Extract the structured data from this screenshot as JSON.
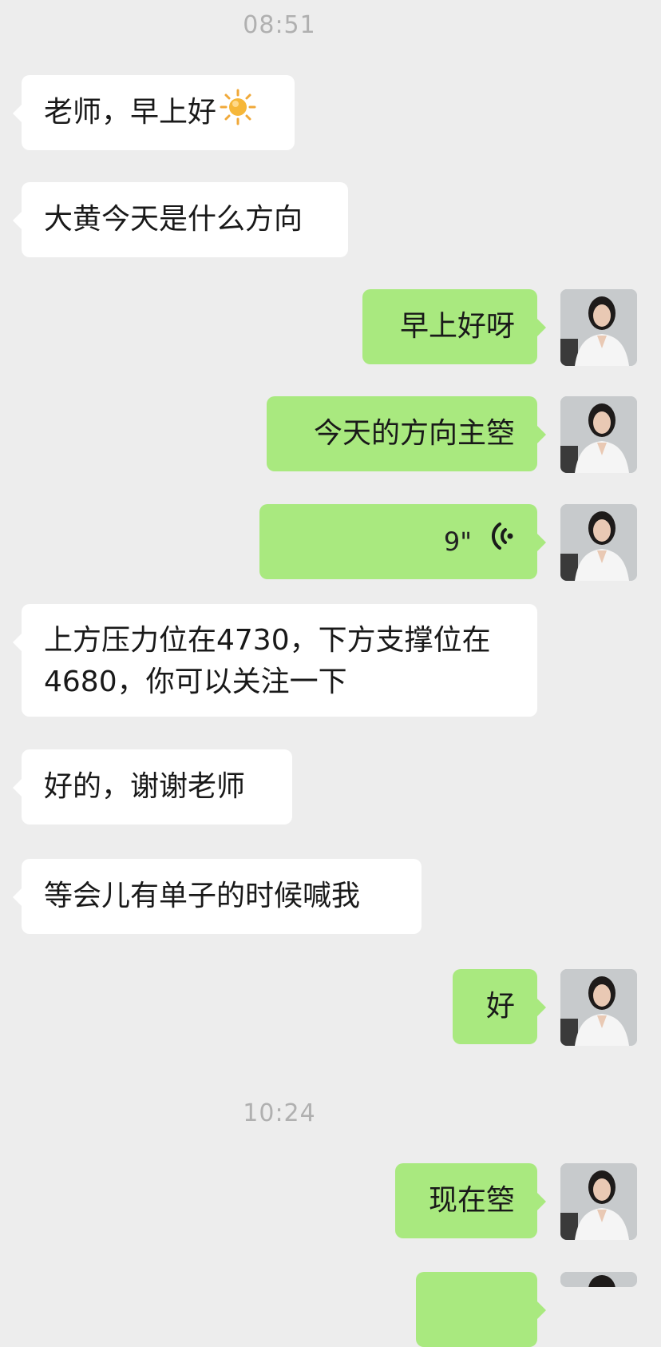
{
  "timestamps": [
    "08:51",
    "10:24"
  ],
  "messages": [
    {
      "side": "in",
      "text": "老师，早上好",
      "emoji": "sun-icon"
    },
    {
      "side": "in",
      "text": "大黄今天是什么方向"
    },
    {
      "side": "out",
      "text": "早上好呀"
    },
    {
      "side": "out",
      "text": "今天的方向主箜"
    },
    {
      "side": "out",
      "type": "voice",
      "duration": "9\""
    },
    {
      "side": "in",
      "text": "上方压力位在4730，下方支撑位在4680，你可以关注一下"
    },
    {
      "side": "in",
      "text": "好的，谢谢老师"
    },
    {
      "side": "in",
      "text": "等会儿有单子的时候喊我"
    },
    {
      "side": "out",
      "text": "好"
    },
    {
      "side": "out",
      "text": "现在箜"
    }
  ],
  "colors": {
    "background": "#ededed",
    "incoming": "#ffffff",
    "outgoing": "#a9e97f",
    "voice_icon": "#1a1a1a"
  }
}
